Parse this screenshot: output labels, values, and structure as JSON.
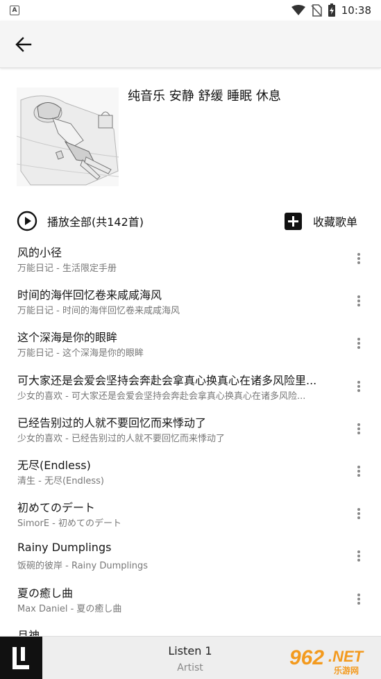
{
  "status_bar": {
    "time": "10:38",
    "left_icon": "A"
  },
  "playlist": {
    "title": "纯音乐 安静 舒缓 睡眠 休息",
    "play_all_label": "播放全部(共142首)",
    "collect_label": "收藏歌单"
  },
  "songs": [
    {
      "title": "风的小径",
      "subtitle": "万能日记 - 生活限定手册"
    },
    {
      "title": "时间的海伴回忆卷来咸咸海风",
      "subtitle": "万能日记 - 时间的海伴回忆卷来咸咸海风"
    },
    {
      "title": "这个深海是你的眼眸",
      "subtitle": "万能日记 - 这个深海是你的眼眸"
    },
    {
      "title": "可大家还是会爱会坚持会奔赴会拿真心换真心在诸多风险里...",
      "subtitle": "少女的喜欢 - 可大家还是会爱会坚持会奔赴会拿真心换真心在诸多风险..."
    },
    {
      "title": "已经告别过的人就不要回忆而来悸动了",
      "subtitle": "少女的喜欢 - 已经告别过的人就不要回忆而来悸动了"
    },
    {
      "title": "无尽(Endless)",
      "subtitle": "清生 - 无尽(Endless)"
    },
    {
      "title": "初めてのデート",
      "subtitle": "SimorE - 初めてのデート"
    },
    {
      "title": "Rainy Dumplings",
      "subtitle": "饭碗的彼岸 - Rainy Dumplings"
    },
    {
      "title": "夏の癒し曲",
      "subtitle": "Max Daniel - 夏の癒し曲"
    },
    {
      "title": "月神",
      "subtitle": ""
    }
  ],
  "player": {
    "title": "Listen 1",
    "artist": "Artist"
  },
  "watermark": {
    "text_962": "962",
    "text_net": ".NET",
    "text_cn": "乐游网"
  },
  "colors": {
    "app_bar": "#f5f5f5",
    "player_bar": "#eeeeee",
    "logo_bg": "#111111",
    "watermark": "#f39a1e"
  }
}
